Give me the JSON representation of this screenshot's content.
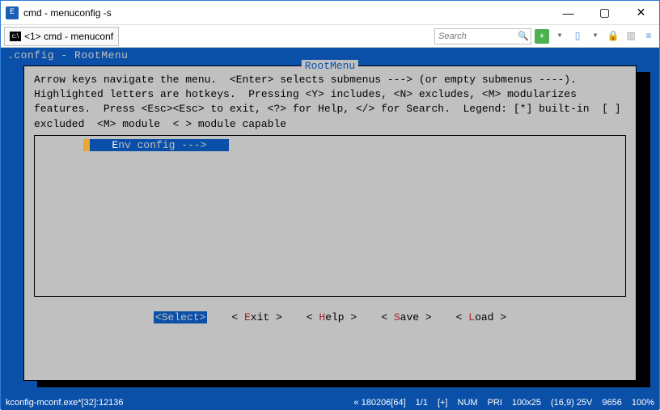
{
  "window": {
    "title": "cmd - menuconfig  -s"
  },
  "tab": {
    "label": "<1> cmd - menuconf"
  },
  "search": {
    "placeholder": "Search"
  },
  "config_line": ".config - RootMenu",
  "box_title": "RootMenu",
  "help_text": "Arrow keys navigate the menu.  <Enter> selects submenus ---> (or empty submenus ----).  Highlighted letters are hotkeys.  Pressing <Y> includes, <N> excludes, <M> modularizes features.  Press <Esc><Esc> to exit, <?> for Help, </> for Search.  Legend: [*] built-in  [ ] excluded  <M> module  < > module capable",
  "menu_item": {
    "hotkey": "E",
    "rest": "nv config  --->"
  },
  "buttons": {
    "select": "Select",
    "exit_hot": "E",
    "exit_rest": "xit",
    "help_hot": "H",
    "help_rest": "elp",
    "save_hot": "S",
    "save_rest": "ave",
    "load_hot": "L",
    "load_rest": "oad"
  },
  "status": {
    "left": "kconfig-mconf.exe*[32]:12136",
    "encoding": "« 180206[64]",
    "pos": "1/1",
    "mode": "[+]",
    "num": "NUM",
    "pri": "PRI",
    "size": "100x25",
    "cursor": "(16,9) 25V",
    "pid": "9656",
    "zoom": "100%"
  }
}
